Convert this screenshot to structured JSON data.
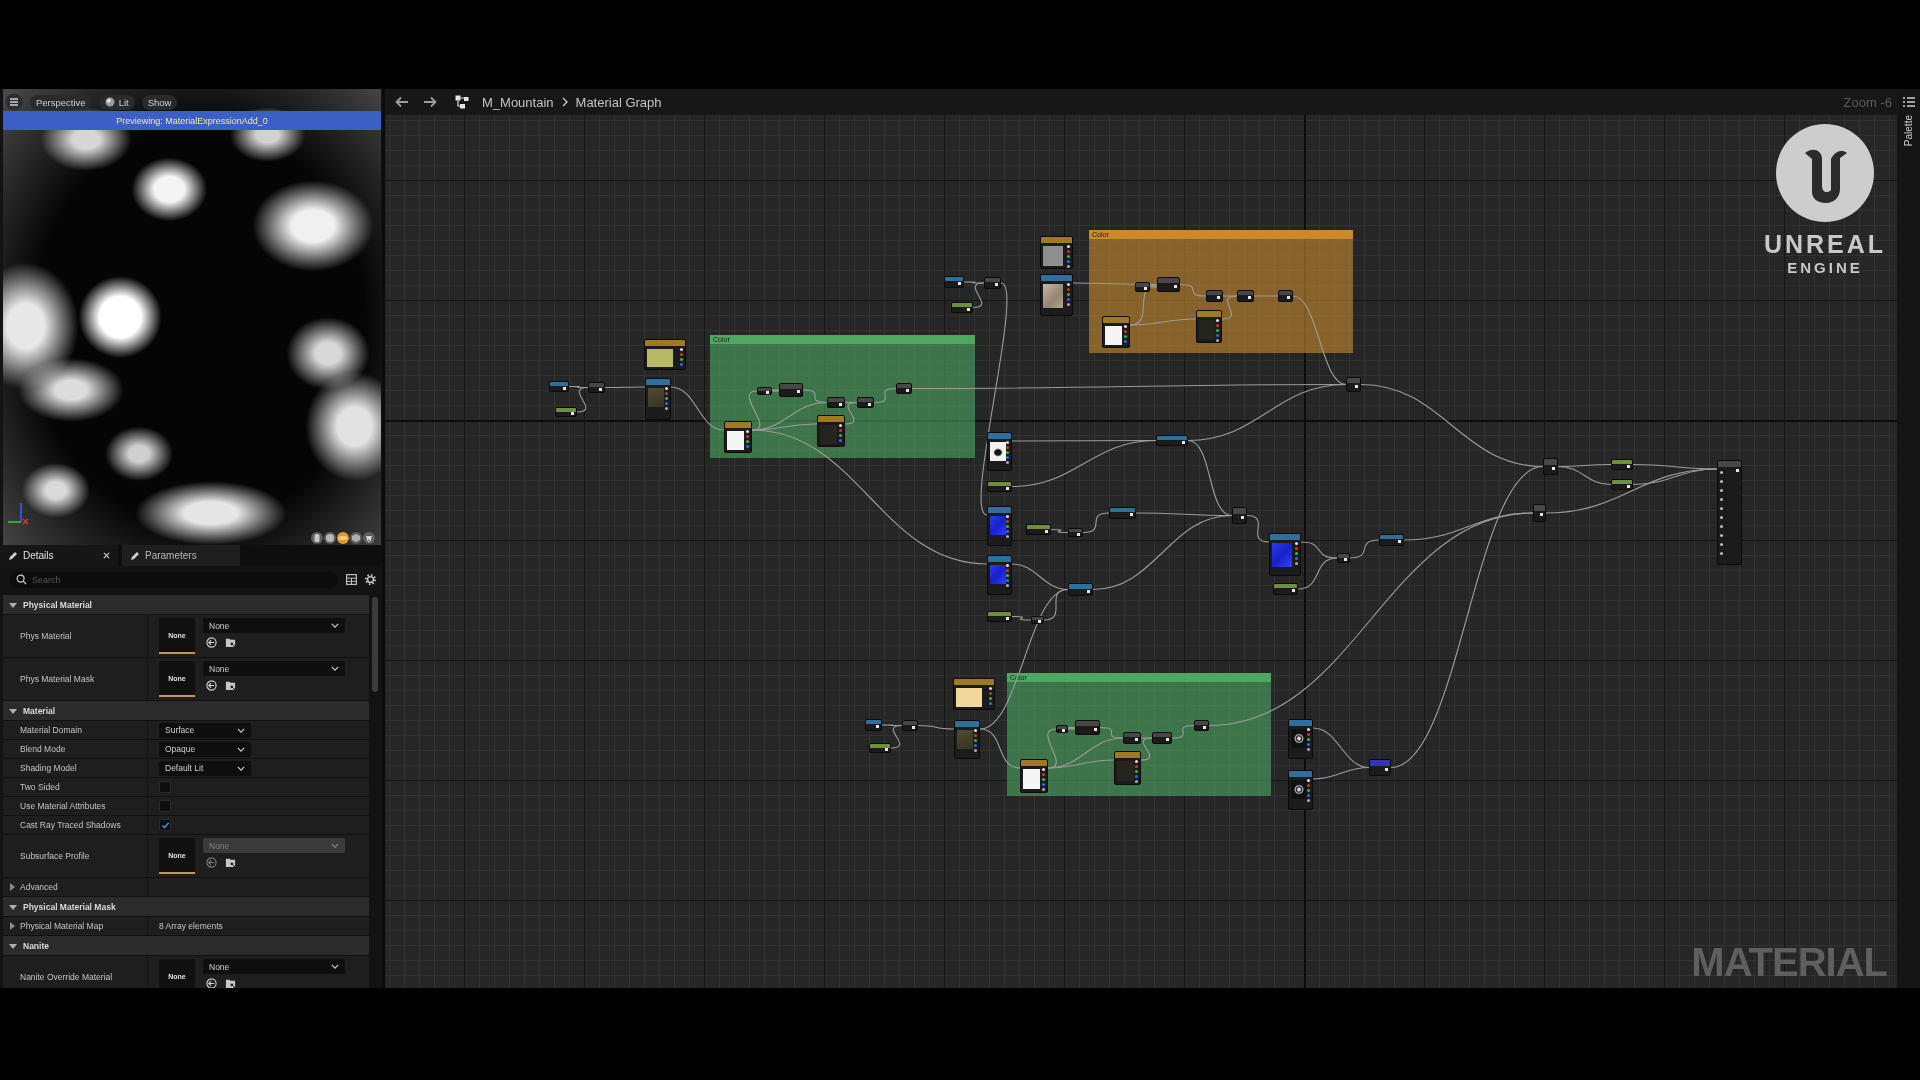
{
  "viewport": {
    "toolbar": [
      {
        "kind": "menu"
      },
      {
        "kind": "text",
        "label": "Perspective"
      },
      {
        "kind": "lit",
        "label": "Lit"
      },
      {
        "kind": "text",
        "label": "Show"
      }
    ],
    "banner": "Previewing: MaterialExpressionAdd_0",
    "preview_shapes": [
      {
        "kind": "cylinder",
        "selected": false
      },
      {
        "kind": "sphere",
        "selected": false
      },
      {
        "kind": "plane",
        "selected": true
      },
      {
        "kind": "cube",
        "selected": false
      },
      {
        "kind": "mesh",
        "selected": false
      }
    ]
  },
  "details_tabs": [
    {
      "label": "Details",
      "selected": true,
      "closable": true
    },
    {
      "label": "Parameters",
      "selected": false,
      "closable": false
    }
  ],
  "details": {
    "search": {
      "placeholder": "Search"
    },
    "sections": [
      {
        "title": "Physical Material",
        "expanded": true,
        "rows": [
          {
            "kind": "asset",
            "label": "Phys Material",
            "thumbnail": "None",
            "value": "None",
            "disabled": false
          },
          {
            "kind": "asset",
            "label": "Phys Material Mask",
            "thumbnail": "None",
            "value": "None",
            "disabled": false
          }
        ]
      },
      {
        "title": "Material",
        "expanded": true,
        "rows": [
          {
            "kind": "dropdown",
            "label": "Material Domain",
            "value": "Surface"
          },
          {
            "kind": "dropdown",
            "label": "Blend Mode",
            "value": "Opaque"
          },
          {
            "kind": "dropdown",
            "label": "Shading Model",
            "value": "Default Lit"
          },
          {
            "kind": "checkbox",
            "label": "Two Sided",
            "checked": false
          },
          {
            "kind": "checkbox",
            "label": "Use Material Attributes",
            "checked": false
          },
          {
            "kind": "checkbox",
            "label": "Cast Ray Traced Shadows",
            "checked": true
          },
          {
            "kind": "asset",
            "label": "Subsurface Profile",
            "thumbnail": "None",
            "value": "None",
            "disabled": true
          },
          {
            "kind": "group",
            "label": "Advanced",
            "expanded": false
          }
        ]
      },
      {
        "title": "Physical Material Mask",
        "expanded": true,
        "rows": [
          {
            "kind": "group",
            "label": "Physical Material Map",
            "expanded": false,
            "value": "8 Array elements"
          }
        ]
      },
      {
        "title": "Nanite",
        "expanded": true,
        "rows": [
          {
            "kind": "asset",
            "label": "Nanite Override Material",
            "thumbnail": "None",
            "value": "None",
            "disabled": false
          }
        ]
      }
    ]
  },
  "graph": {
    "breadcrumb": [
      "M_Mountain",
      "Material Graph"
    ],
    "zoom_label": "Zoom -6",
    "comments": [
      {
        "title": "Color",
        "color": "#c98a2e"
      },
      {
        "title": "Color",
        "color": "#4fa862"
      },
      {
        "title": "Color",
        "color": "#4fa862"
      }
    ]
  },
  "palette_tab": {
    "label": "Palette"
  },
  "overlay": {
    "logo_lines": [
      "UNREAL",
      "ENGINE"
    ],
    "title": "MATERIAL"
  }
}
